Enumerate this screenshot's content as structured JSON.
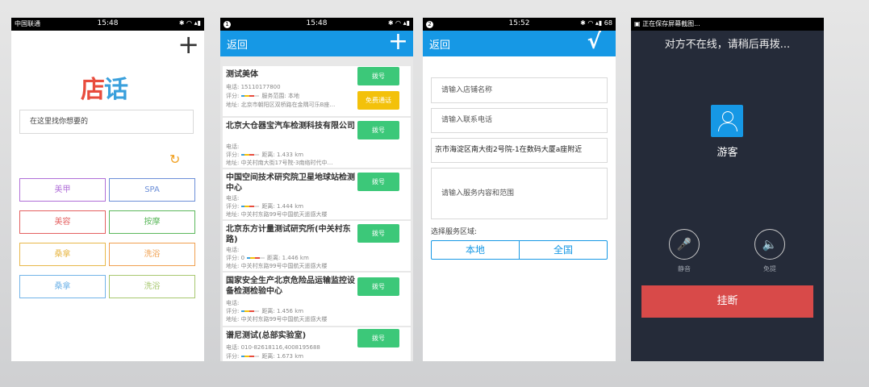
{
  "screen1": {
    "status": {
      "carrier": "中国联通",
      "time": "15:48",
      "icons": "✱ ◠ ▴▮"
    },
    "add_icon": "+",
    "logo": {
      "part1": "店",
      "part2": "话",
      "colors": [
        "#e84c3d",
        "#3aa0dc"
      ]
    },
    "search_placeholder": "在这里找你想要的",
    "refresh_icon": "↻",
    "categories": [
      {
        "label": "美甲",
        "color": "#b06fd8"
      },
      {
        "label": "SPA",
        "color": "#6c8fd8"
      },
      {
        "label": "美容",
        "color": "#e46060"
      },
      {
        "label": "按摩",
        "color": "#5cb85c"
      },
      {
        "label": "桑拿",
        "color": "#e8b84a"
      },
      {
        "label": "洗浴",
        "color": "#f0a050"
      },
      {
        "label": "桑拿",
        "color": "#72b4e8"
      },
      {
        "label": "洗浴",
        "color": "#a8c870"
      }
    ]
  },
  "screen2": {
    "status": {
      "badge": "1",
      "time": "15:48",
      "icons": "✱ ◠ ▴▮"
    },
    "back": "返回",
    "add_icon": "+",
    "items": [
      {
        "name": "测试美体",
        "l1": "电话: 15110177800",
        "l2": "评分:",
        "l2b": "服务范围: 本地",
        "l3": "地址: 北京市朝阳区双桥路在金隅可乐B座…",
        "btn": "拨号",
        "btn2": "免费通话"
      },
      {
        "name": "北京大仓器宝汽车检测科技有限公司",
        "l1": "电话:",
        "l2": "评分:",
        "l2b": "距离: 1.433 km",
        "l3": "地址: 中关村南大街17号院-3南络时代中…",
        "btn": "拨号"
      },
      {
        "name": "中国空间技术研究院卫星地球站检测中心",
        "l1": "电话:",
        "l2": "评分:",
        "l2b": "距离: 1.444 km",
        "l3": "地址: 中关村东路99号中国航天遥感大楼",
        "btn": "拨号"
      },
      {
        "name": "北京东方计量测试研究所(中关村东路)",
        "l1": "电话:",
        "l2": "评分: 0",
        "l2b": "距离: 1.446 km",
        "l3": "地址: 中关村东路99号中国航天遥感大楼",
        "btn": "拨号"
      },
      {
        "name": "国家安全生产北京危险品运输监控设备检测检验中心",
        "l1": "电话:",
        "l2": "评分:",
        "l2b": "距离: 1.456 km",
        "l3": "地址: 中关村东路99号中国航天遥感大楼",
        "btn": "拨号"
      },
      {
        "name": "谱尼测试(总部实验室)",
        "l1": "电话: 010-82618116,4008195688",
        "l2": "评分:",
        "l2b": "距离: 1.673 km",
        "l3": "",
        "btn": "拨号"
      }
    ]
  },
  "screen3": {
    "status": {
      "badge": "2",
      "time": "15:52",
      "icons": "✱ ◠ ▴▮ 68"
    },
    "back": "返回",
    "confirm_icon": "√",
    "shop_name_placeholder": "请输入店铺名称",
    "phone_placeholder": "请输入联系电话",
    "address_value": "京市海淀区南大街2号院-1在数码大厦a座附近",
    "service_placeholder": "请输入服务内容和范围",
    "region_label": "选择服务区域:",
    "region_options": [
      "本地",
      "全国"
    ]
  },
  "screen4": {
    "status_text": "▣ 正在保存屏幕截图...",
    "notice": "对方不在线，请稍后再拨...",
    "caller": "游客",
    "mute_label": "静音",
    "mute_icon": "🎤",
    "speaker_label": "免提",
    "speaker_icon": "🔈",
    "hangup": "挂断"
  }
}
